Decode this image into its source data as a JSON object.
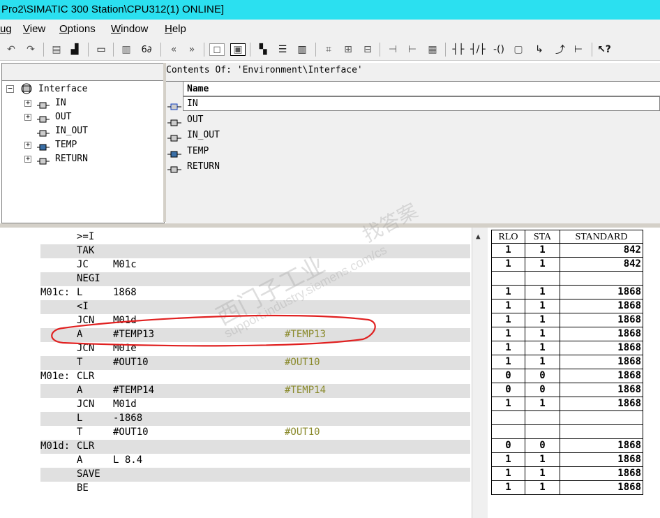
{
  "title": "Pro2\\SIMATIC 300 Station\\CPU312(1)  ONLINE]",
  "menu": [
    "ug",
    "View",
    "Options",
    "Window",
    "Help"
  ],
  "contents_title": "Contents Of:  'Environment\\Interface'",
  "tree": {
    "root": "Interface",
    "items": [
      "IN",
      "OUT",
      "IN_OUT",
      "TEMP",
      "RETURN"
    ]
  },
  "name_column": {
    "header": "Name",
    "items": [
      "IN",
      "OUT",
      "IN_OUT",
      "TEMP",
      "RETURN"
    ]
  },
  "code_lines": [
    {
      "label": "",
      "op": ">=I",
      "operand": "",
      "comment": ""
    },
    {
      "label": "",
      "op": "TAK",
      "operand": "",
      "comment": ""
    },
    {
      "label": "",
      "op": "JC",
      "operand": "M01c",
      "comment": ""
    },
    {
      "label": "",
      "op": "NEGI",
      "operand": "",
      "comment": ""
    },
    {
      "label": "M01c:",
      "op": "L",
      "operand": "1868",
      "comment": ""
    },
    {
      "label": "",
      "op": "<I",
      "operand": "",
      "comment": ""
    },
    {
      "label": "",
      "op": "JCN",
      "operand": "M01d",
      "comment": ""
    },
    {
      "label": "",
      "op": "A",
      "operand": "#TEMP13",
      "comment": "#TEMP13"
    },
    {
      "label": "",
      "op": "JCN",
      "operand": "M01e",
      "comment": ""
    },
    {
      "label": "",
      "op": "T",
      "operand": "#OUT10",
      "comment": "#OUT10"
    },
    {
      "label": "M01e:",
      "op": "CLR",
      "operand": "",
      "comment": ""
    },
    {
      "label": "",
      "op": "A",
      "operand": "#TEMP14",
      "comment": "#TEMP14"
    },
    {
      "label": "",
      "op": "JCN",
      "operand": "M01d",
      "comment": ""
    },
    {
      "label": "",
      "op": "L",
      "operand": "-1868",
      "comment": ""
    },
    {
      "label": "",
      "op": "T",
      "operand": "#OUT10",
      "comment": "#OUT10"
    },
    {
      "label": "M01d:",
      "op": "CLR",
      "operand": "",
      "comment": ""
    },
    {
      "label": "",
      "op": "A",
      "operand": "L      8.4",
      "comment": ""
    },
    {
      "label": "",
      "op": "SAVE",
      "operand": "",
      "comment": ""
    },
    {
      "label": "",
      "op": "BE",
      "operand": "",
      "comment": ""
    }
  ],
  "status_table": {
    "headers": [
      "RLO",
      "STA",
      "STANDARD"
    ],
    "rows": [
      [
        "1",
        "1",
        "842"
      ],
      [
        "1",
        "1",
        "842"
      ],
      [
        "",
        "",
        ""
      ],
      [
        "1",
        "1",
        "1868"
      ],
      [
        "1",
        "1",
        "1868"
      ],
      [
        "1",
        "1",
        "1868"
      ],
      [
        "1",
        "1",
        "1868"
      ],
      [
        "1",
        "1",
        "1868"
      ],
      [
        "1",
        "1",
        "1868"
      ],
      [
        "0",
        "0",
        "1868"
      ],
      [
        "0",
        "0",
        "1868"
      ],
      [
        "1",
        "1",
        "1868"
      ],
      [
        "",
        "",
        ""
      ],
      [
        "",
        "",
        ""
      ],
      [
        "0",
        "0",
        "1868"
      ],
      [
        "1",
        "1",
        "1868"
      ],
      [
        "1",
        "1",
        "1868"
      ],
      [
        "1",
        "1",
        "1868"
      ]
    ]
  },
  "watermark": {
    "line1": "西门子工业",
    "line2": "support.industry.siemens.com/cs",
    "line3": "找答案"
  },
  "colors": {
    "title_bar": "#2be0f0",
    "comment_text": "#8a8a2c",
    "annotation": "#e02020"
  }
}
